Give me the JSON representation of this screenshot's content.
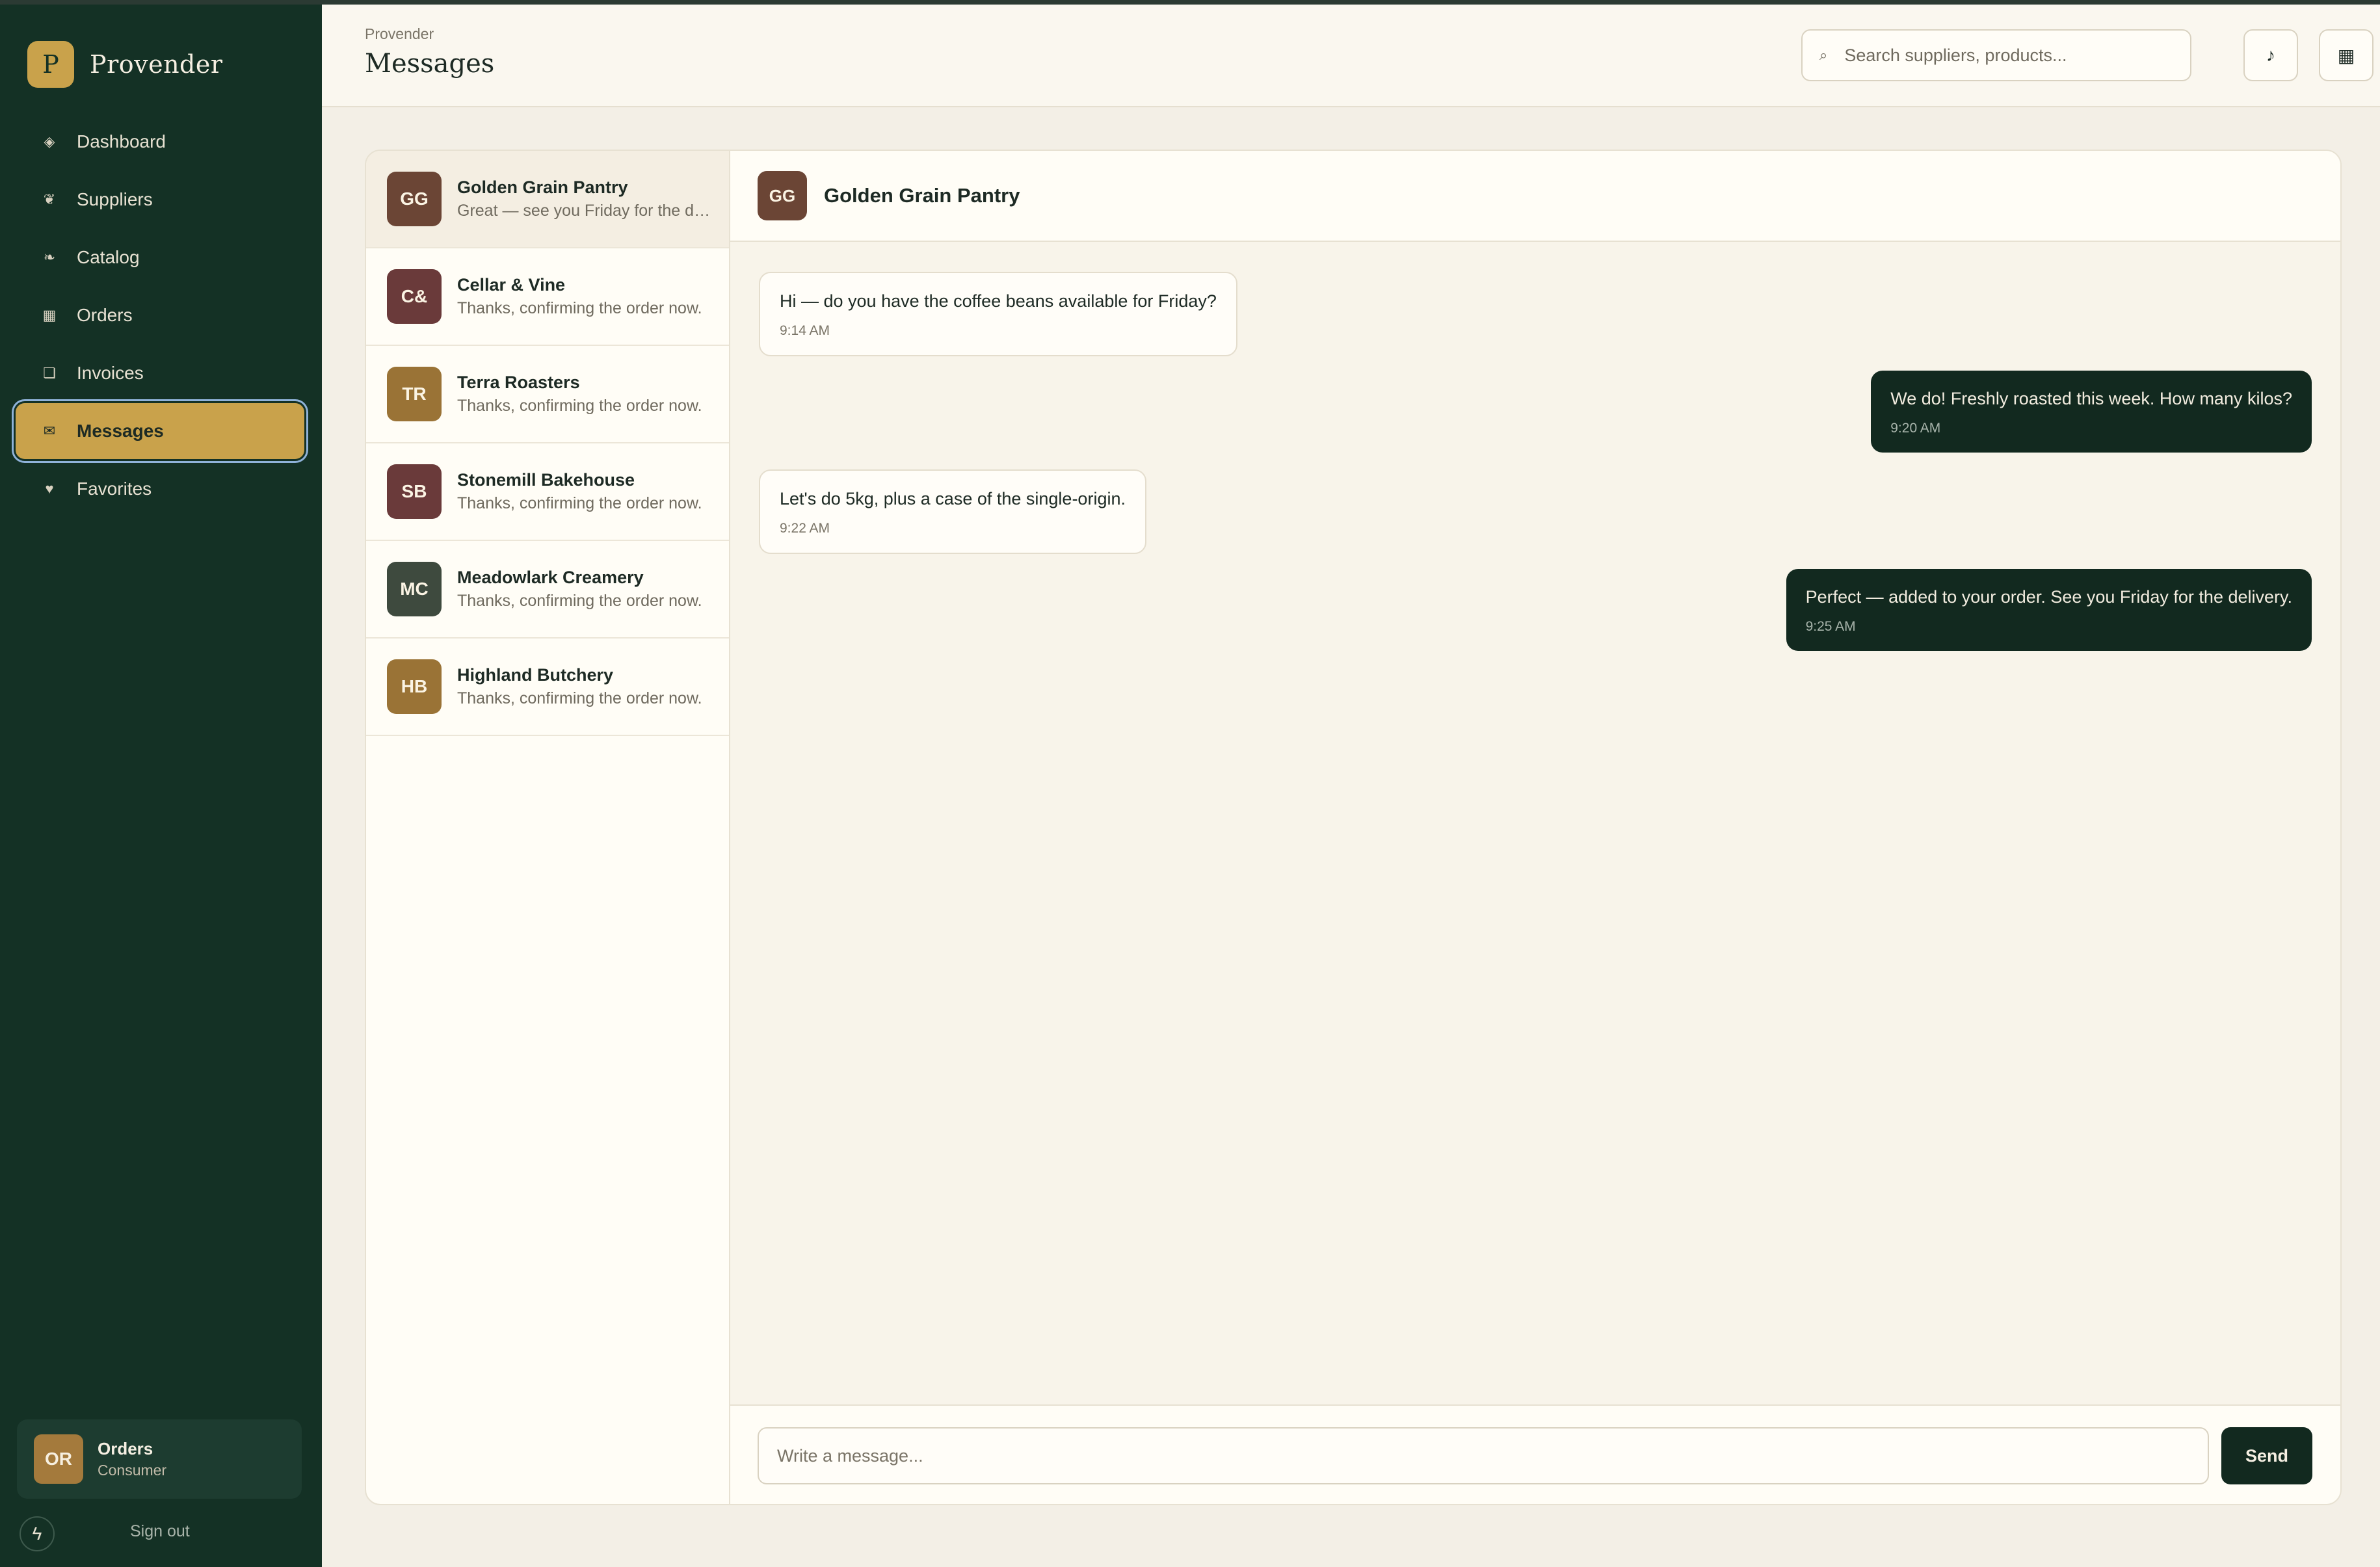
{
  "app": {
    "name": "Provender",
    "logo_letter": "P"
  },
  "sidebar": {
    "items": [
      {
        "label": "Dashboard",
        "icon": "◈",
        "icon_name": "diamond-icon"
      },
      {
        "label": "Suppliers",
        "icon": "❦",
        "icon_name": "suppliers-icon"
      },
      {
        "label": "Catalog",
        "icon": "❧",
        "icon_name": "leaf-icon"
      },
      {
        "label": "Orders",
        "icon": "▦",
        "icon_name": "orders-icon"
      },
      {
        "label": "Invoices",
        "icon": "❏",
        "icon_name": "invoice-icon"
      },
      {
        "label": "Messages",
        "icon": "✉",
        "icon_name": "mail-icon",
        "active": true
      },
      {
        "label": "Favorites",
        "icon": "♥",
        "icon_name": "heart-icon"
      }
    ],
    "user": {
      "initials": "OR",
      "name": "Orders",
      "role": "Consumer"
    },
    "bolt_icon": "ϟ",
    "sign_out": "Sign out"
  },
  "header": {
    "breadcrumb": "Provender",
    "title": "Messages",
    "search_placeholder": "Search suppliers, products...",
    "search_icon": "⌕",
    "music_icon": "♪",
    "grid_icon": "▦"
  },
  "conversations": [
    {
      "initials": "GG",
      "name": "Golden Grain Pantry",
      "preview": "Great — see you Friday for the delivery.",
      "color": "#6b4535",
      "active": true
    },
    {
      "initials": "C&",
      "name": "Cellar & Vine",
      "preview": "Thanks, confirming the order now.",
      "color": "#6a3a3a"
    },
    {
      "initials": "TR",
      "name": "Terra Roasters",
      "preview": "Thanks, confirming the order now.",
      "color": "#9a7336"
    },
    {
      "initials": "SB",
      "name": "Stonemill Bakehouse",
      "preview": "Thanks, confirming the order now.",
      "color": "#6a3a3a"
    },
    {
      "initials": "MC",
      "name": "Meadowlark Creamery",
      "preview": "Thanks, confirming the order now.",
      "color": "#3e4a3e"
    },
    {
      "initials": "HB",
      "name": "Highland Butchery",
      "preview": "Thanks, confirming the order now.",
      "color": "#9a7336"
    }
  ],
  "chat": {
    "initials": "GG",
    "title": "Golden Grain Pantry",
    "avatar_color": "#6b4535",
    "messages": [
      {
        "text": "Hi — do you have the coffee beans available for Friday?",
        "time": "9:14 AM",
        "dir": "in"
      },
      {
        "text": "We do! Freshly roasted this week. How many kilos?",
        "time": "9:20 AM",
        "dir": "out"
      },
      {
        "text": "Let's do 5kg, plus a case of the single-origin.",
        "time": "9:22 AM",
        "dir": "in"
      },
      {
        "text": "Perfect — added to your order. See you Friday for the delivery.",
        "time": "9:25 AM",
        "dir": "out"
      }
    ],
    "composer_placeholder": "Write a message...",
    "send_label": "Send"
  },
  "colors": {
    "sidebar_bg": "#143125",
    "accent": "#c9a24b",
    "bubble_out": "#12291f"
  }
}
